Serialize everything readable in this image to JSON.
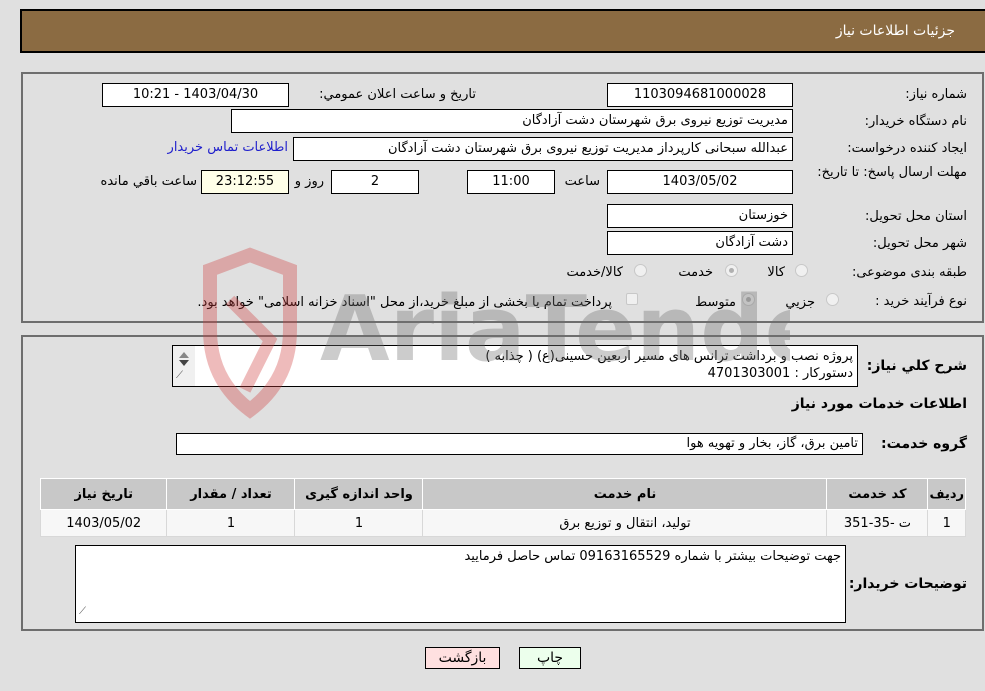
{
  "header": {
    "title": "جزئیات اطلاعات نیاز"
  },
  "form": {
    "need_number_label": "شماره نیاز:",
    "need_number": "1103094681000028",
    "announce_label": "تاریخ و ساعت اعلان عمومي:",
    "announce_value": "1403/04/30 - 10:21",
    "buyer_org_label": "نام دستگاه خریدار:",
    "buyer_org": "مدیریت توزیع نیروی برق شهرستان دشت آزادگان",
    "creator_label": "ایجاد کننده درخواست:",
    "creator": "عبدالله سبحانی کارپرداز مدیریت توزیع نیروی برق شهرستان دشت آزادگان",
    "contact_link": "اطلاعات تماس خریدار",
    "deadline_label": "مهلت ارسال پاسخ: تا تاریخ:",
    "deadline_date": "1403/05/02",
    "time_label": "ساعت",
    "deadline_time": "11:00",
    "days_value": "2",
    "days_label": "روز و",
    "remaining_time": "23:12:55",
    "remaining_label": "ساعت باقي مانده",
    "province_label": "استان محل تحویل:",
    "province": "خوزستان",
    "city_label": "شهر محل تحویل:",
    "city": "دشت آزادگان",
    "category_label": "طبقه بندی موضوعی:",
    "category_options": [
      {
        "label": "کالا",
        "checked": false
      },
      {
        "label": "خدمت",
        "checked": true
      },
      {
        "label": "کالا/خدمت",
        "checked": false
      }
    ],
    "process_label": "نوع فرآیند خرید :",
    "process_options": [
      {
        "label": "جزيي",
        "checked": false
      },
      {
        "label": "متوسط",
        "checked": true
      }
    ],
    "treasury_note": "پرداخت تمام یا بخشی از مبلغ خرید،از محل \"اسناد خزانه اسلامی\" خواهد بود."
  },
  "details": {
    "description_label": "شرح کلي نياز:",
    "description_line1": "پروژه نصب و برداشت ترانس های مسیر اربعین حسینی(ع) ( چذابه )",
    "description_line2": "دستورکار : 4701303001",
    "services_heading": "اطلاعات خدمات مورد نیاز",
    "service_group_label": "گروه خدمت:",
    "service_group": "تامین برق، گاز، بخار و تهویه هوا",
    "table": {
      "headers": [
        "ردیف",
        "کد خدمت",
        "نام خدمت",
        "واحد اندازه گیری",
        "تعداد / مقدار",
        "تاریخ نیاز"
      ],
      "rows": [
        [
          "1",
          "ت -35-351",
          "تولید، انتقال و توزیع برق",
          "1",
          "1",
          "1403/05/02"
        ]
      ]
    },
    "buyer_notes_label": "توضیحات خریدار:",
    "buyer_notes": "جهت توضیحات بیشتر با شماره 09163165529 تماس حاصل فرمایید"
  },
  "buttons": {
    "print": "چاپ",
    "back": "بازگشت"
  },
  "watermark": {
    "text": "AriaTender.neT"
  }
}
